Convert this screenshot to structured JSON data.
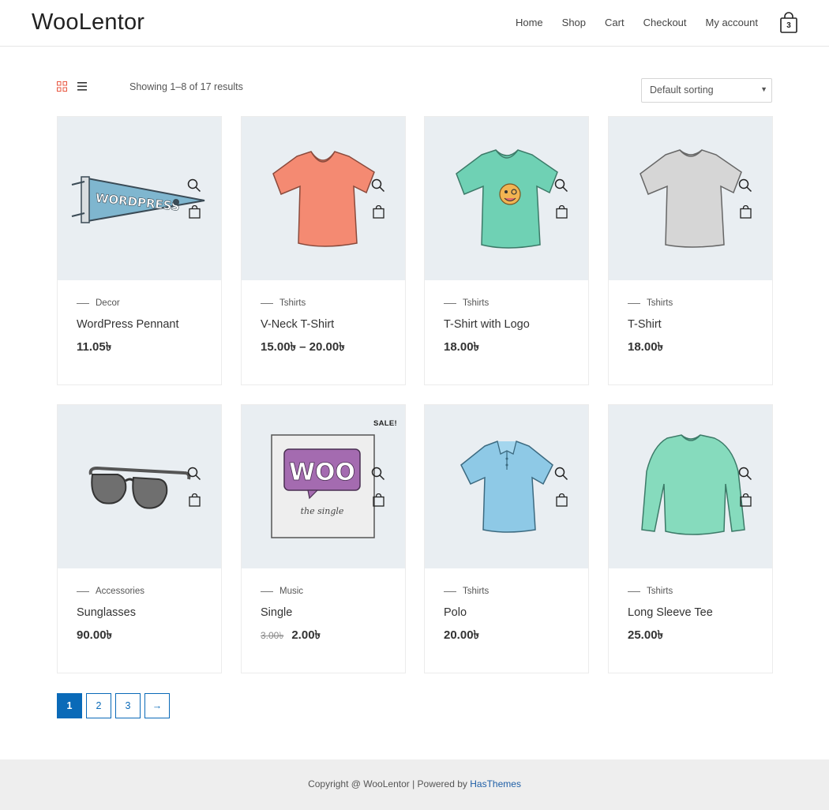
{
  "header": {
    "logo": "WooLentor",
    "nav": [
      "Home",
      "Shop",
      "Cart",
      "Checkout",
      "My account"
    ],
    "cart_count": "3",
    "cart_icon": "shopping-bag-icon"
  },
  "toolbar": {
    "grid_icon": "grid-view-icon",
    "list_icon": "list-view-icon",
    "result_count": "Showing 1–8 of 17 results",
    "sorting_selected": "Default sorting"
  },
  "products": [
    {
      "category": "Decor",
      "title": "WordPress Pennant",
      "price": "11.05৳",
      "image": "wordpress-pennant"
    },
    {
      "category": "Tshirts",
      "title": "V-Neck T-Shirt",
      "price": "15.00৳  – 20.00৳",
      "image": "vneck-tshirt"
    },
    {
      "category": "Tshirts",
      "title": "T-Shirt with Logo",
      "price": "18.00৳",
      "image": "tshirt-logo"
    },
    {
      "category": "Tshirts",
      "title": "T-Shirt",
      "price": "18.00৳",
      "image": "tshirt"
    },
    {
      "category": "Accessories",
      "title": "Sunglasses",
      "price": "90.00৳",
      "image": "sunglasses"
    },
    {
      "category": "Music",
      "title": "Single",
      "price_old": "3.00৳",
      "price": "2.00৳",
      "sale": "SALE!",
      "image": "single-album",
      "image_text": "WOO",
      "image_subtext": "the single"
    },
    {
      "category": "Tshirts",
      "title": "Polo",
      "price": "20.00৳",
      "image": "polo"
    },
    {
      "category": "Tshirts",
      "title": "Long Sleeve Tee",
      "price": "25.00৳",
      "image": "long-sleeve-tee"
    }
  ],
  "pagination": {
    "pages": [
      "1",
      "2",
      "3"
    ],
    "current": "1",
    "next": "→"
  },
  "footer": {
    "text": "Copyright @ WooLentor | Powered by ",
    "link": "HasThemes"
  },
  "colors": {
    "accent": "#0a6ab8",
    "thumb_bg": "#e9eef2",
    "footer_bg": "#eeeeee"
  }
}
